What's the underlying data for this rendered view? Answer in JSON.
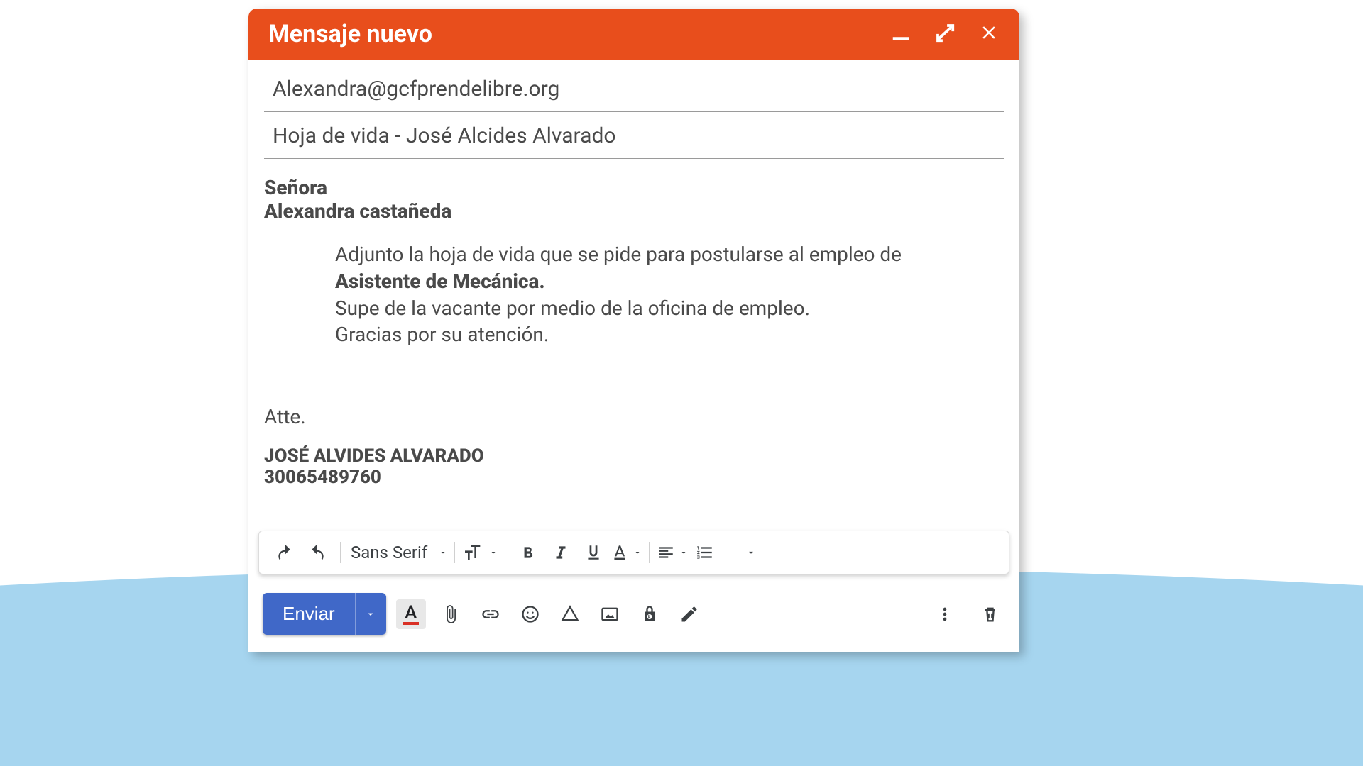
{
  "header": {
    "title": "Mensaje nuevo"
  },
  "fields": {
    "to": "Alexandra@gcfprendelibre.org",
    "subject": "Hoja de vida - José Alcides Alvarado"
  },
  "body": {
    "greeting_title": "Señora",
    "greeting_name": "Alexandra castañeda",
    "para_part1": "Adjunto la hoja de vida que se pide para postularse al empleo de ",
    "para_bold": "Asistente de Mecánica.",
    "para_part2": "Supe de la vacante por medio de la oficina de empleo.",
    "para_part3": "Gracias por su atención.",
    "closing": "Atte.",
    "signature_name": "JOSÉ ALVIDES ALVARADO",
    "signature_phone": "30065489760"
  },
  "format_toolbar": {
    "font_family": "Sans Serif"
  },
  "bottom_bar": {
    "send_label": "Enviar",
    "text_color_glyph": "A"
  }
}
